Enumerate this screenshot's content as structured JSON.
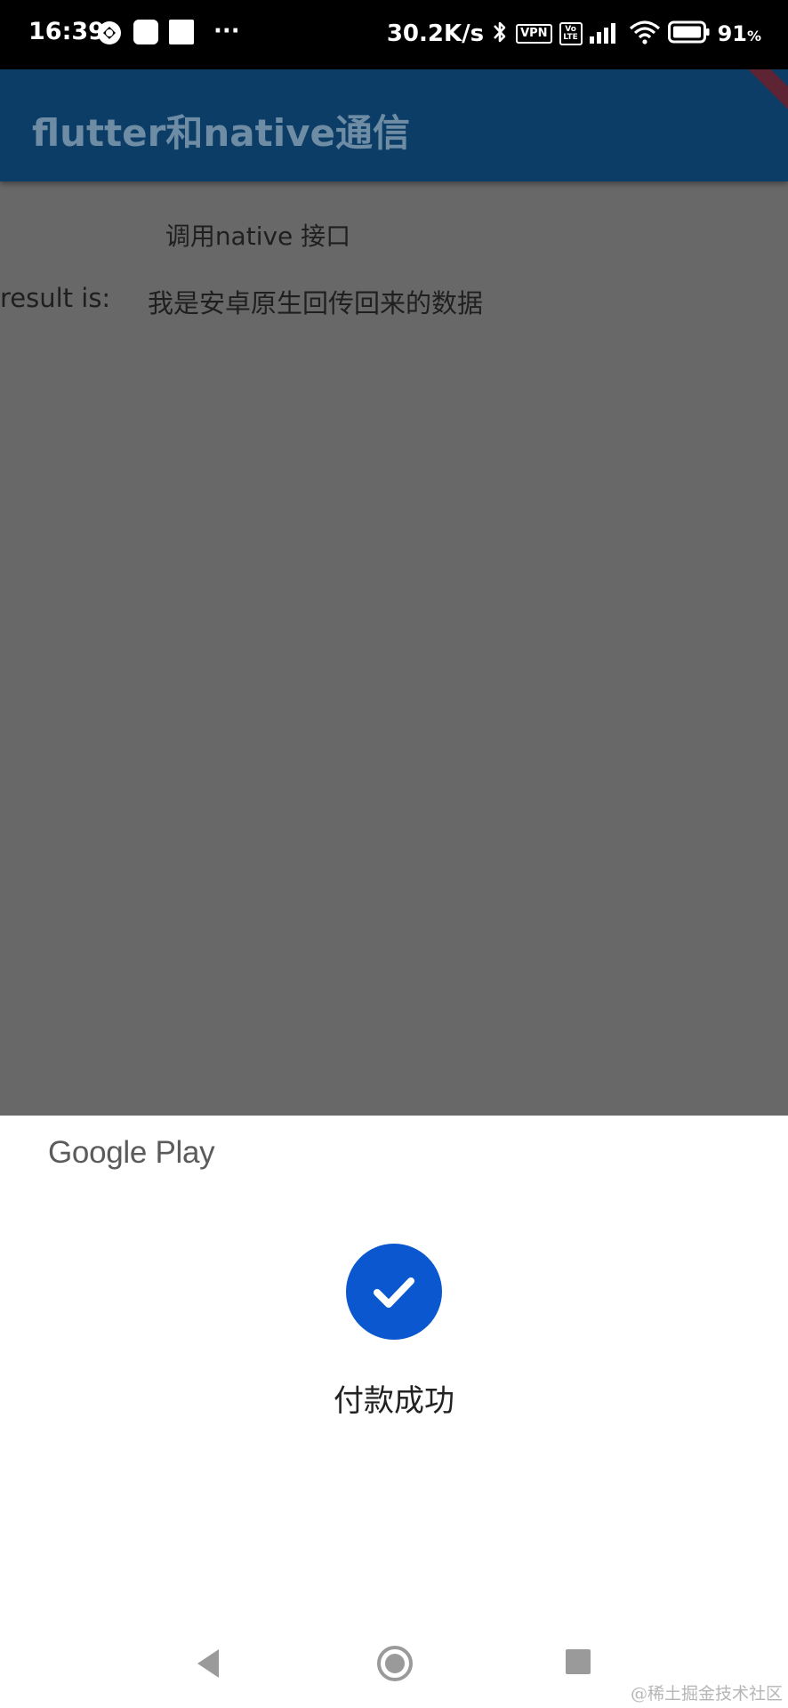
{
  "status_bar": {
    "time": "16:39",
    "net_speed": "30.2K/s",
    "vpn_badge": "VPN",
    "volte_badge": "Vo LTE",
    "battery_percent": "91",
    "battery_unit": "%",
    "more_dots": "···"
  },
  "app_bar": {
    "title": "flutter和native通信"
  },
  "main": {
    "call_button_label": "调用native 接口",
    "result_label": "result is:",
    "result_value": "我是安卓原生回传回来的数据"
  },
  "payment_sheet": {
    "brand": "Google Play",
    "status_text": "付款成功",
    "accent_color": "#0b57d0"
  },
  "watermark": "@稀土掘金技术社区"
}
